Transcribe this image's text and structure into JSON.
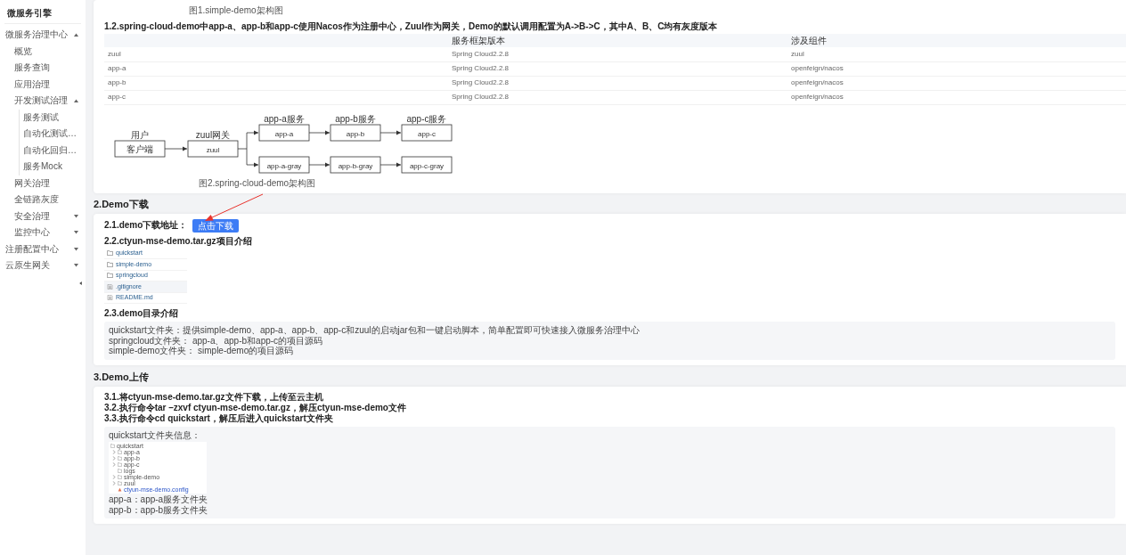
{
  "sidebar": {
    "title": "微服务引擎",
    "items": [
      {
        "label": "微服务治理中心",
        "expanded": true,
        "children": [
          {
            "label": "概览"
          },
          {
            "label": "服务查询"
          },
          {
            "label": "应用治理"
          },
          {
            "label": "开发测试治理",
            "expanded": true,
            "children": [
              {
                "label": "服务测试"
              },
              {
                "label": "自动化测试…"
              },
              {
                "label": "自动化回归…"
              },
              {
                "label": "服务Mock"
              }
            ]
          },
          {
            "label": "网关治理"
          },
          {
            "label": "全链路灰度"
          },
          {
            "label": "安全治理",
            "expanded": false
          },
          {
            "label": "监控中心",
            "expanded": false
          }
        ]
      },
      {
        "label": "注册配置中心",
        "expanded": false
      },
      {
        "label": "云原生网关",
        "expanded": false
      }
    ]
  },
  "overview": {
    "figure_caption": "图1.simple-demo架构图",
    "heading": "1.2.spring-cloud-demo中app-a、app-b和app-c使用Nacos作为注册中心，Zuul作为网关，Demo的默认调用配置为A->B->C，其中A、B、C均有灰度版本",
    "table": {
      "columns": [
        "",
        "服务框架版本",
        "涉及组件"
      ],
      "rows": [
        [
          "zuul",
          "Spring Cloud2.2.8",
          "zuul"
        ],
        [
          "app-a",
          "Spring Cloud2.2.8",
          "openfeign/nacos"
        ],
        [
          "app-b",
          "Spring Cloud2.2.8",
          "openfeign/nacos"
        ],
        [
          "app-c",
          "Spring Cloud2.2.8",
          "openfeign/nacos"
        ]
      ]
    },
    "diagram": {
      "nodes": [
        {
          "title": "用户",
          "label": "客户端"
        },
        {
          "title": "zuul网关",
          "label": "zuul"
        },
        {
          "title": "app-a服务",
          "label": "app-a"
        },
        {
          "title": "app-b服务",
          "label": "app-b"
        },
        {
          "title": "app-c服务",
          "label": "app-c"
        },
        {
          "label": "app-a-gray"
        },
        {
          "label": "app-b-gray"
        },
        {
          "label": "app-c-gray"
        }
      ],
      "caption": "图2.spring-cloud-demo架构图"
    }
  },
  "download": {
    "title": "2.Demo下载",
    "address_label": "2.1.demo下载地址：",
    "button": "点击下载",
    "files_heading": "2.2.ctyun-mse-demo.tar.gz项目介绍",
    "files": [
      {
        "kind": "folder",
        "name": "quickstart",
        "selected": false
      },
      {
        "kind": "folder",
        "name": "simple-demo",
        "selected": false
      },
      {
        "kind": "folder",
        "name": "springcloud",
        "selected": false
      },
      {
        "kind": "file",
        "name": ".gitignore",
        "selected": true
      },
      {
        "kind": "file",
        "name": "README.md",
        "selected": false
      }
    ],
    "dir_heading": "2.3.demo目录介绍",
    "dir_lines": [
      "quickstart文件夹：提供simple-demo、app-a、app-b、app-c和zuul的启动jar包和一键启动脚本，简单配置即可快速接入微服务治理中心",
      "springcloud文件夹： app-a、app-b和app-c的项目源码",
      "simple-demo文件夹： simple-demo的项目源码"
    ]
  },
  "upload": {
    "title": "3.Demo上传",
    "steps": [
      "3.1.将ctyun-mse-demo.tar.gz文件下载，上传至云主机",
      "3.2.执行命令tar –zxvf ctyun-mse-demo.tar.gz，解压ctyun-mse-demo文件",
      "3.3.执行命令cd quickstart，解压后进入quickstart文件夹"
    ],
    "info_title": "quickstart文件夹信息：",
    "tree": [
      {
        "kind": "root",
        "name": "quickstart"
      },
      {
        "kind": "folder",
        "name": "app-a"
      },
      {
        "kind": "folder",
        "name": "app-b"
      },
      {
        "kind": "folder",
        "name": "app-c"
      },
      {
        "kind": "empty_folder",
        "name": "logs"
      },
      {
        "kind": "folder",
        "name": "simple-demo"
      },
      {
        "kind": "folder",
        "name": "zuul"
      },
      {
        "kind": "file",
        "name": "ctyun-mse-demo.config"
      }
    ],
    "lines": [
      "app-a：app-a服务文件夹",
      "app-b：app-b服务文件夹"
    ]
  }
}
